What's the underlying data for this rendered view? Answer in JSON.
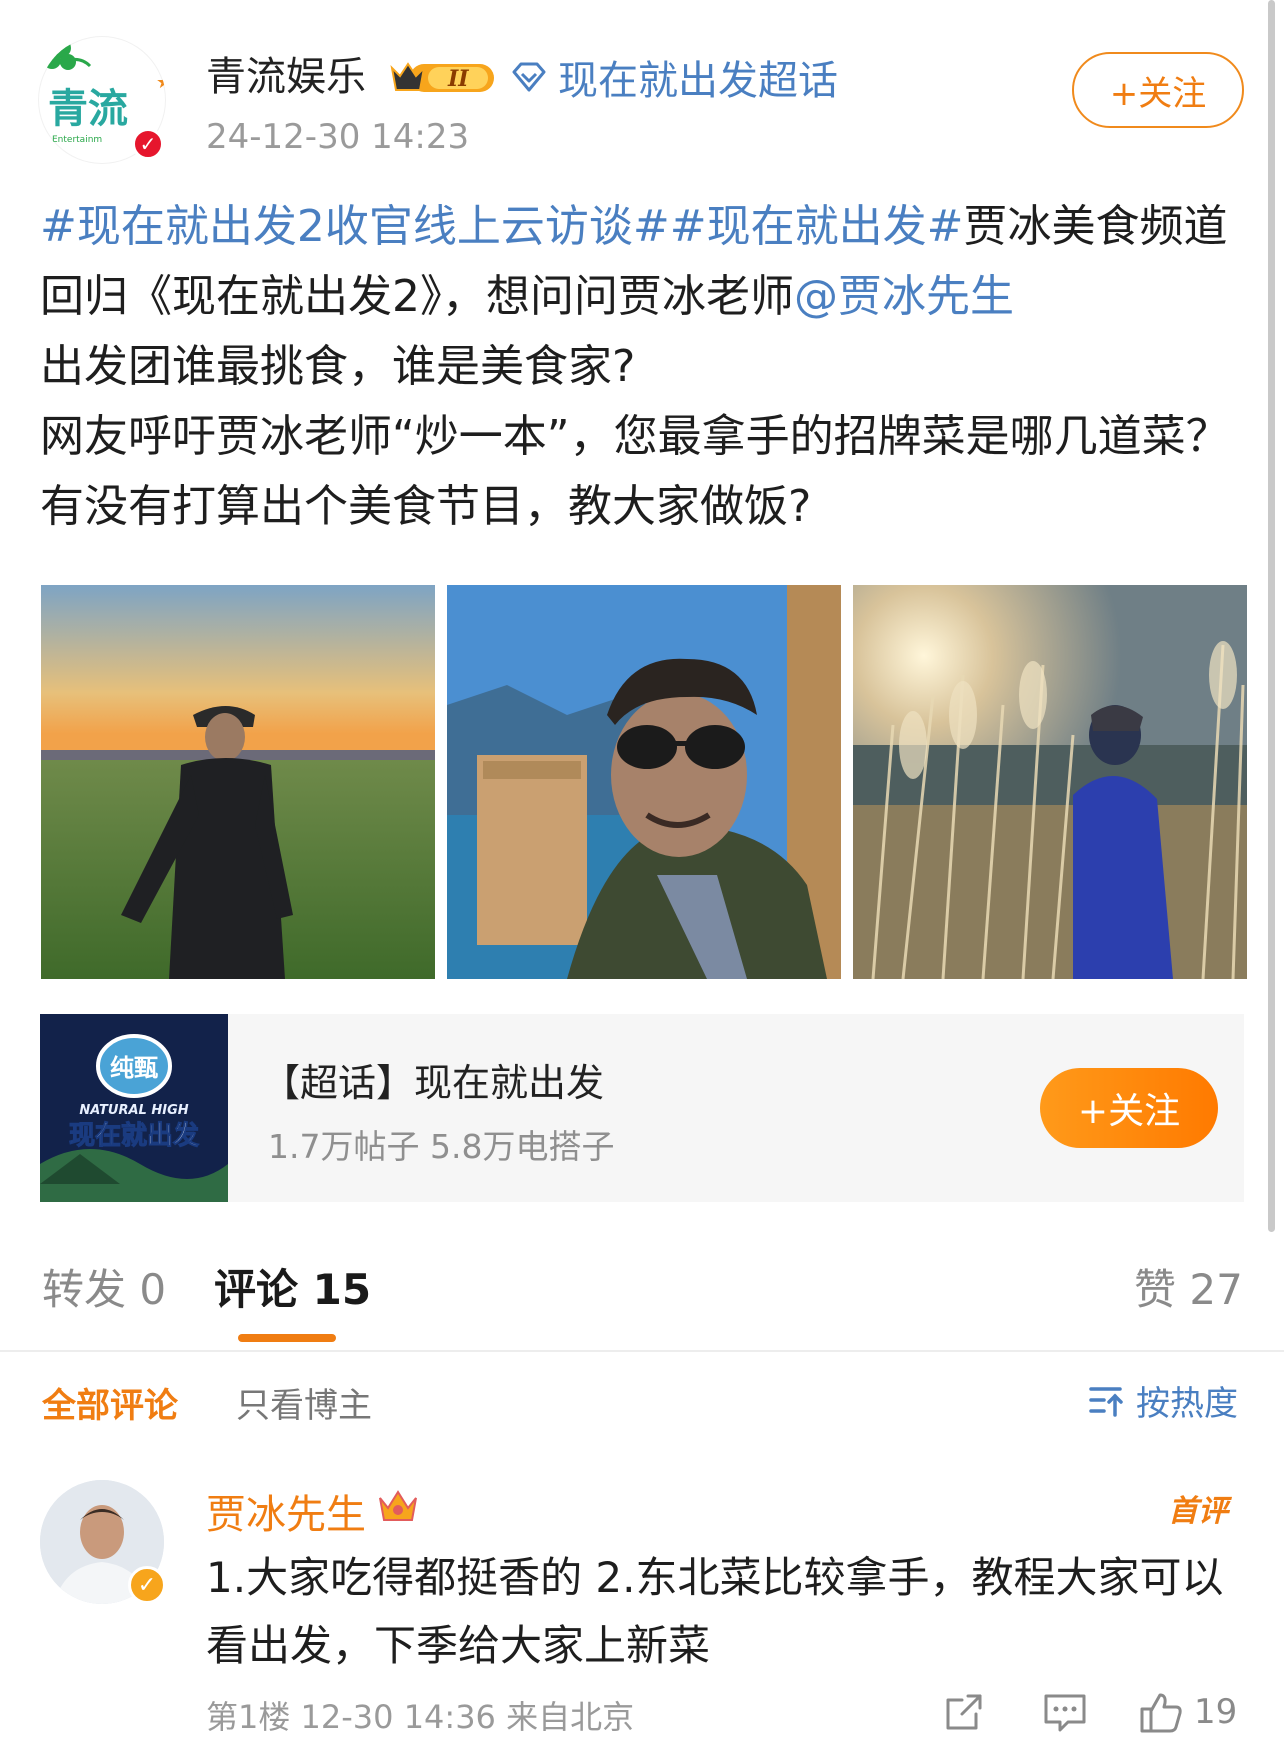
{
  "post": {
    "author": {
      "name": "青流娱乐",
      "avatar_logo_text": "青流",
      "avatar_sub_text": "Entertainm",
      "verified_icon": "verified-v-icon"
    },
    "vip_badge_text": "II",
    "supertopic_label": "现在就出发超话",
    "time": "24-12-30 14:23",
    "follow_label": "+关注",
    "tag1": "#现在就出发2收官线上云访谈#",
    "tag2": "#现在就出发#",
    "text1": "贾冰美食频道回归《现在就出发2》，想问问贾冰老师",
    "mention": "@贾冰先生",
    "text2": "出发团谁最挑食，谁是美食家?",
    "text3": "网友呼吁贾冰老师“炒一本”，您最拿手的招牌菜是哪几道菜？有没有打算出个美食节目，教大家做饭?"
  },
  "photos": [
    {
      "name": "photo-grassland-sunset"
    },
    {
      "name": "photo-sunglasses-portrait"
    },
    {
      "name": "photo-reeds-sunset"
    }
  ],
  "topic_card": {
    "title": "【超话】现在就出发",
    "stats": "1.7万帖子 5.8万电搭子",
    "follow_label": "+关注",
    "thumb_texts": [
      "纯甄",
      "NATURAL HIGH",
      "现在就出发"
    ]
  },
  "tabs": {
    "repost": "转发 0",
    "comment": "评论 15",
    "like": "赞 27"
  },
  "filters": {
    "all": "全部评论",
    "owner_only": "只看博主",
    "sort": "按热度"
  },
  "comment": {
    "author": "贾冰先生",
    "badge": "首评",
    "text": "1.大家吃得都挺香的 2.东北菜比较拿手，教程大家可以看出发，下季给大家上新菜",
    "floor_meta": "第1楼 12-30 14:36 来自北京",
    "like_count": "19"
  },
  "colors": {
    "accent_orange": "#f07d12",
    "link_blue": "#4a7fc1",
    "verify_red": "#e6162d"
  }
}
